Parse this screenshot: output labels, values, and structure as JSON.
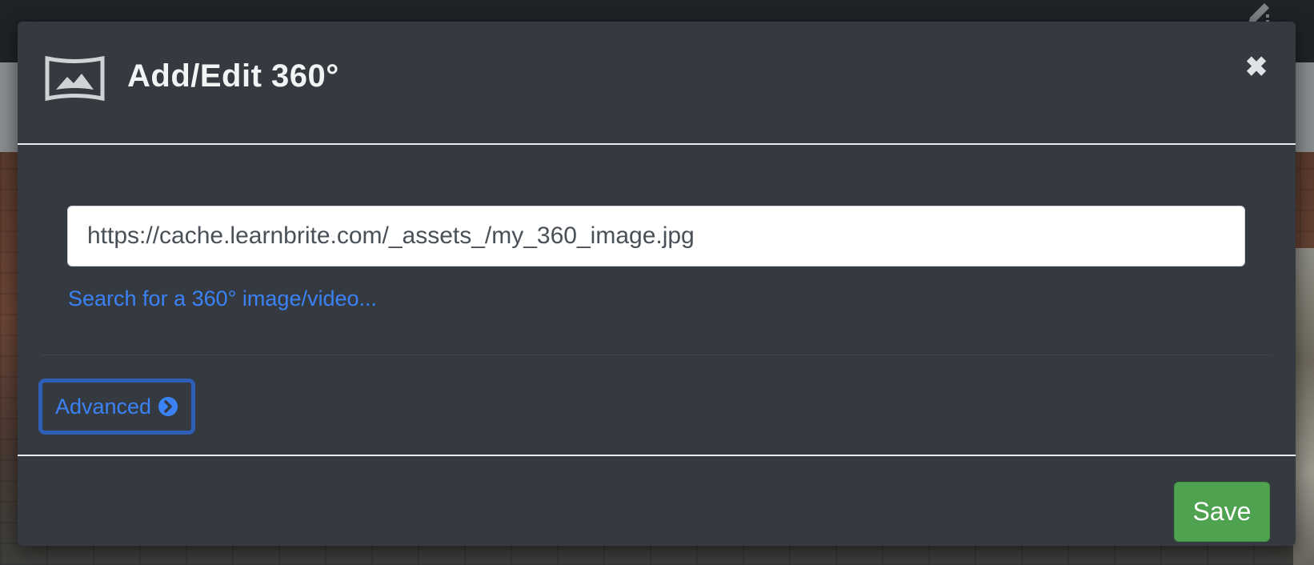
{
  "modal": {
    "title": "Add/Edit 360°",
    "header_icon": "panorama-icon",
    "close_icon": "close-icon",
    "close_glyph": "✖"
  },
  "form": {
    "url_value": "https://cache.learnbrite.com/_assets_/my_360_image.jpg",
    "search_link": "Search for a 360° image/video...",
    "advanced_label": "Advanced",
    "advanced_icon": "chevron-circle-right-icon"
  },
  "footer": {
    "save_label": "Save"
  },
  "colors": {
    "modal_bg": "#343a40",
    "link": "#3b82f6",
    "save": "#4fa24f",
    "advanced_border": "#2f5eb6"
  }
}
